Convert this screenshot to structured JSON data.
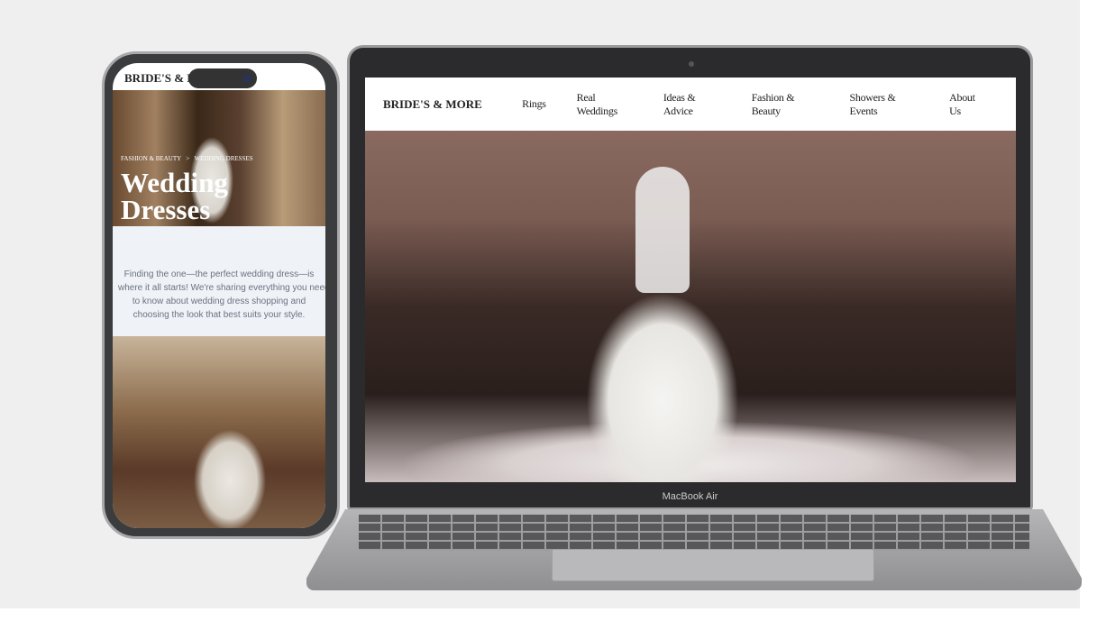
{
  "laptop": {
    "brand": "BRIDE'S & MORE",
    "nav": [
      "Rings",
      "Real Weddings",
      "Ideas & Advice",
      "Fashion & Beauty",
      "Showers & Events",
      "About Us"
    ],
    "device_label": "MacBook Air"
  },
  "phone": {
    "brand": "BRIDE'S & MORE",
    "breadcrumb": [
      "FASHION & BEAUTY",
      ">",
      "WEDDING DRESSES"
    ],
    "title_line1": "Wedding",
    "title_line2": "Dresses",
    "intro": [
      "Finding the one—the perfect wedding dress—is",
      "where it all starts! We're sharing everything you need",
      "to know about wedding dress shopping and",
      "choosing the look that best suits your style."
    ]
  }
}
